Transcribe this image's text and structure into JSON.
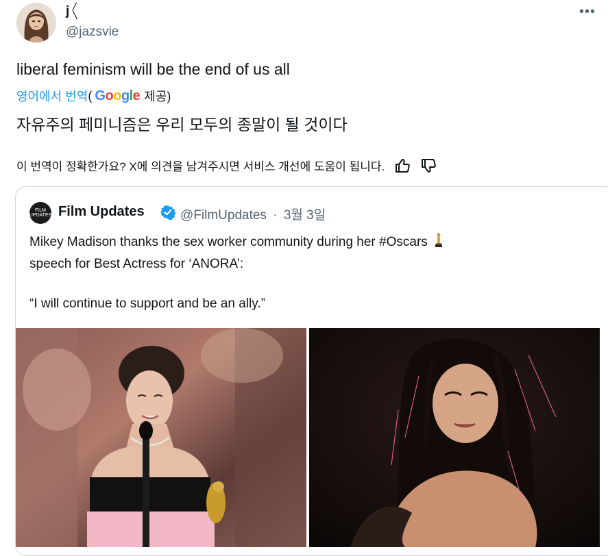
{
  "author": {
    "display_name": "j",
    "handle": "@jazsvie"
  },
  "tweet": {
    "text": "liberal feminism will be the end of us all",
    "translate_link": "영어에서 번역",
    "translate_open_paren": "(",
    "translate_provider_suffix": "제공)",
    "google_logo_text": "Google",
    "translated_text": "자유주의 페미니즘은 우리 모두의 종말이 될 것이다",
    "feedback_prompt": "이 번역이 정확한가요? X에 의견을 남겨주시면 서비스 개선에 도움이 됩니다."
  },
  "quote": {
    "author_name": "Film Updates",
    "handle": "@FilmUpdates",
    "separator": "·",
    "date": "3월 3일",
    "avatar_text": "FILM UPDATES",
    "text_line1": "Mikey Madison thanks the sex worker community during her #Oscars",
    "text_line2": "speech for Best Actress for ‘ANORA’:",
    "text_line3": "“I will continue to support and be an ally.”"
  },
  "icons": {
    "more": "more-icon",
    "thumbs_up": "thumbs-up-icon",
    "thumbs_down": "thumbs-down-icon",
    "verified": "verified-badge-icon",
    "oscar": "oscar-trophy-icon"
  },
  "colors": {
    "link": "#1d9bf0",
    "secondary_text": "#536471",
    "verified": "#1d9bf0",
    "border": "#cfd9de"
  }
}
